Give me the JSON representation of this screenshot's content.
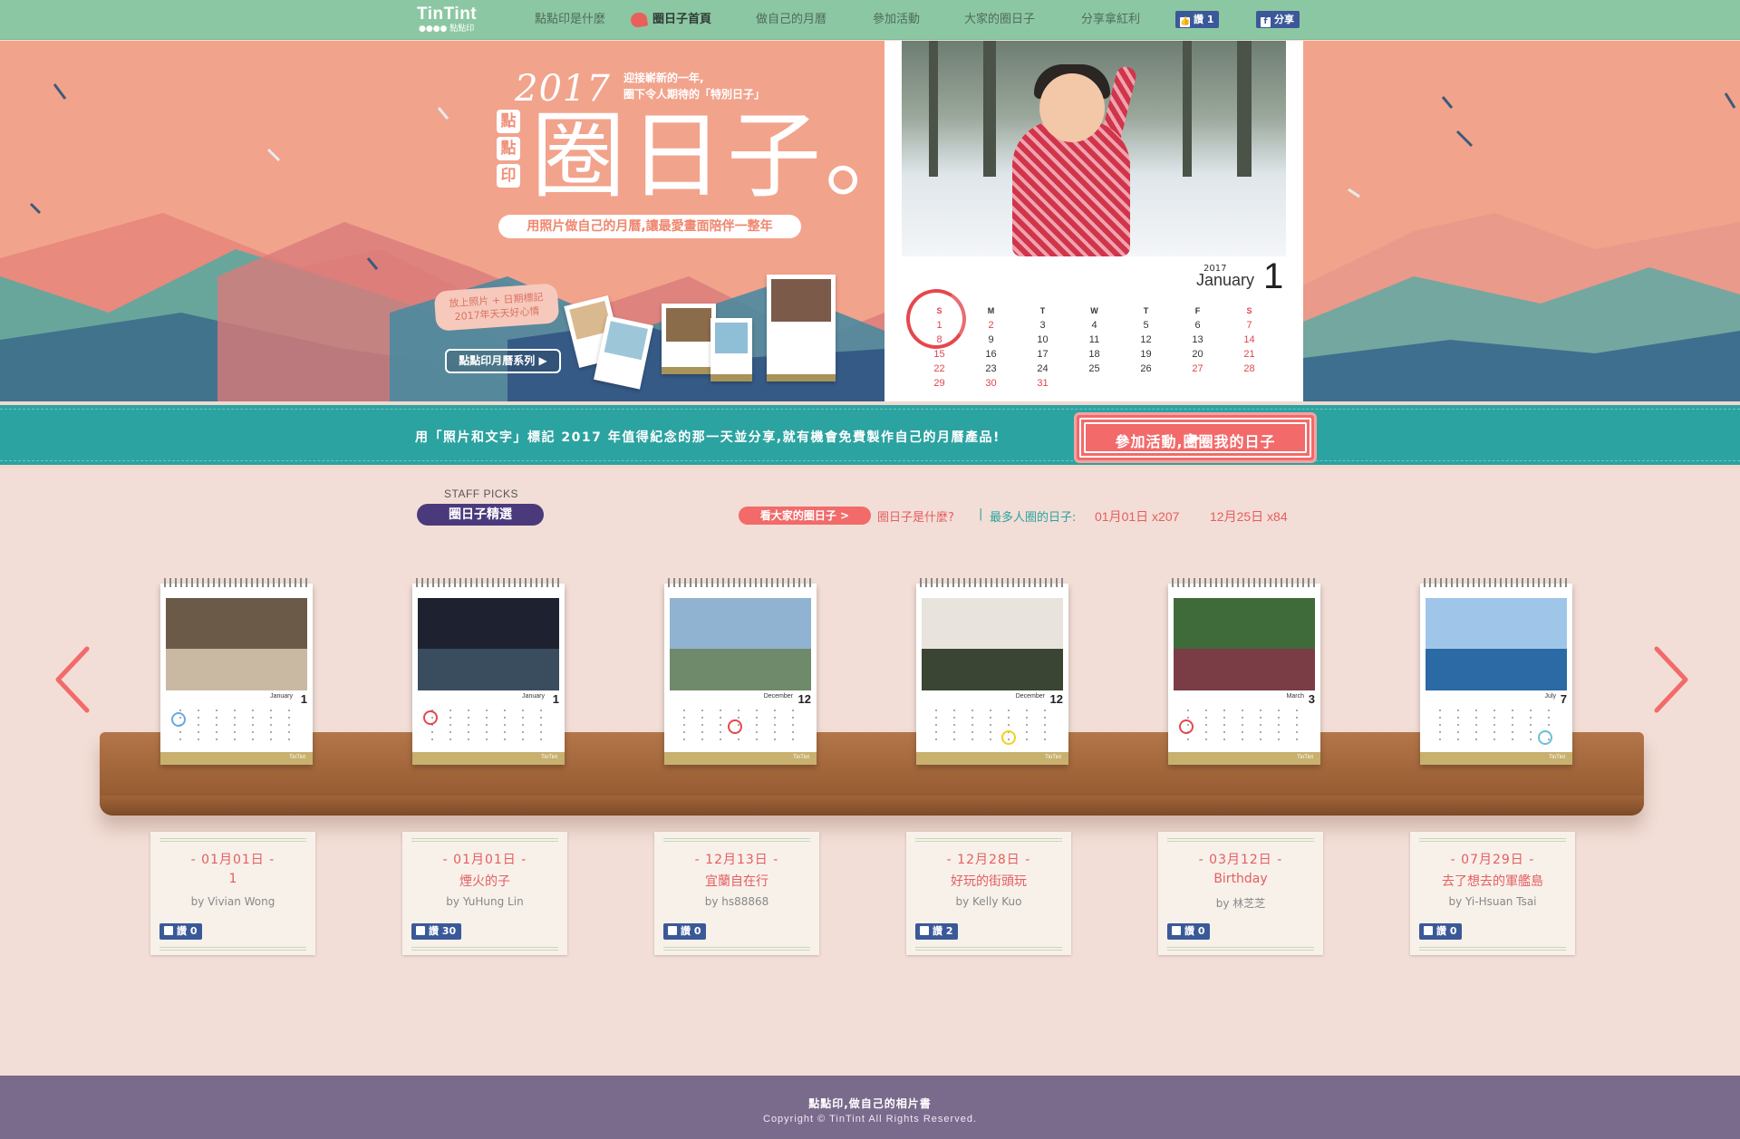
{
  "nav": {
    "logo": "TinTint",
    "logo_sub": "●●●● 點點印",
    "items": [
      "點點印是什麼",
      "圈日子首頁",
      "做自己的月曆",
      "參加活動",
      "大家的圈日子",
      "分享拿紅利"
    ],
    "fb_like": "讚 1",
    "fb_share": "分享",
    "accent": "#8cc7a3"
  },
  "hero": {
    "year": "2017",
    "intro_line1": "迎接嶄新的一年,",
    "intro_line2": "圈下令人期待的「特別日子」",
    "badge_chars": [
      "點",
      "點",
      "印"
    ],
    "title": "圈日子。",
    "subtitle": "用照片做自己的月曆,讓最愛畫面陪伴一整年",
    "bubble_line1": "放上照片 + 日期標記",
    "bubble_line2": "2017年天天好心情",
    "series_button": "點點印月曆系列",
    "background": "#f2a38c"
  },
  "feature_calendar": {
    "year": "2017",
    "month": "January",
    "day": "1",
    "weekdays": [
      "S",
      "M",
      "T",
      "W",
      "T",
      "F",
      "S"
    ],
    "rows": [
      [
        "1",
        "2",
        "3",
        "4",
        "5",
        "6",
        "7"
      ],
      [
        "8",
        "9",
        "10",
        "11",
        "12",
        "13",
        "14"
      ],
      [
        "15",
        "16",
        "17",
        "18",
        "19",
        "20",
        "21"
      ],
      [
        "22",
        "23",
        "24",
        "25",
        "26",
        "27",
        "28"
      ],
      [
        "29",
        "30",
        "31",
        "",
        "",
        "",
        ""
      ]
    ]
  },
  "banner": {
    "text": "用「照片和文字」標記 2017 年值得紀念的那一天並分享,就有機會免費製作自己的月曆產品!",
    "cta": "參加活動,圈圈我的日子",
    "color": "#2ba3a1",
    "cta_color": "#f26a6a"
  },
  "picks": {
    "label": "STAFF PICKS",
    "title": "圈日子精選",
    "all_button": "看大家的圈日子 >",
    "what_link": "圈日子是什麼?",
    "separator": "|",
    "most_label": "最多人圈的日子:",
    "most_values": [
      "01月01日 x207",
      "12月25日 x84"
    ]
  },
  "shelf_calendars": [
    {
      "month": "January",
      "day": "1",
      "colors": [
        "#6b5a48",
        "#c9b9a2"
      ]
    },
    {
      "month": "January",
      "day": "1",
      "colors": [
        "#1e2230",
        "#3a4d5e"
      ]
    },
    {
      "month": "December",
      "day": "12",
      "colors": [
        "#8fb3d0",
        "#6f8a6a"
      ]
    },
    {
      "month": "December",
      "day": "12",
      "colors": [
        "#e8e4dd",
        "#3b4533"
      ]
    },
    {
      "month": "March",
      "day": "3",
      "colors": [
        "#3f6b3a",
        "#7a3c45"
      ]
    },
    {
      "month": "July",
      "day": "7",
      "colors": [
        "#9fc6e8",
        "#2b6aa5"
      ]
    }
  ],
  "cards": [
    {
      "date": "- 01月01日 -",
      "title": "1",
      "by": "by Vivian Wong",
      "likes": "讚 0"
    },
    {
      "date": "- 01月01日 -",
      "title": "煙火的子",
      "by": "by YuHung Lin",
      "likes": "讚 30"
    },
    {
      "date": "- 12月13日 -",
      "title": "宜蘭自在行",
      "by": "by hs88868",
      "likes": "讚 0"
    },
    {
      "date": "- 12月28日 -",
      "title": "好玩的街頭玩",
      "by": "by Kelly Kuo",
      "likes": "讚 2"
    },
    {
      "date": "- 03月12日 -",
      "title": "Birthday",
      "by": "by 林芝芝",
      "likes": "讚 0"
    },
    {
      "date": "- 07月29日 -",
      "title": "去了想去的軍艦島",
      "by": "by Yi-Hsuan Tsai",
      "likes": "讚 0"
    }
  ],
  "footer": {
    "line1": "點點印,做自己的相片書",
    "line2": "Copyright © TinTint All Rights Reserved."
  }
}
